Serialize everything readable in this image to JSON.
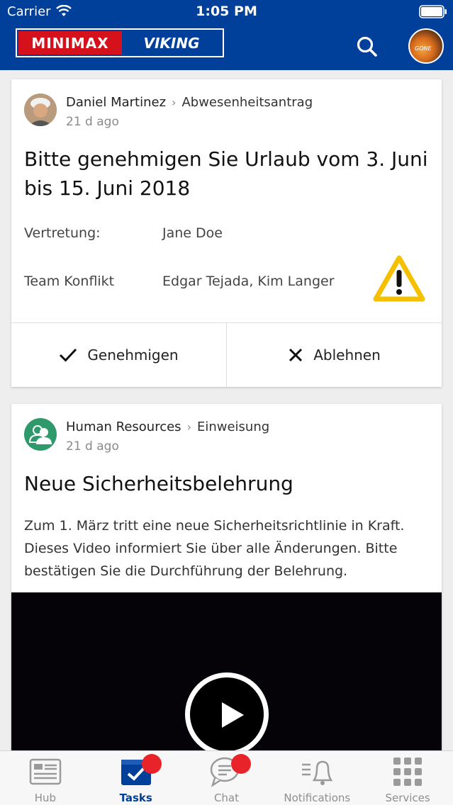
{
  "status_bar": {
    "carrier": "Carrier",
    "time": "1:05 PM"
  },
  "header": {
    "logo_left": "MINIMAX",
    "logo_right": "VIKING",
    "search_icon": "search-icon",
    "avatar_caption": "GONE"
  },
  "posts": [
    {
      "author": "Daniel Martinez",
      "type": "Abwesenheitsantrag",
      "time": "21 d ago",
      "title": "Bitte genehmigen Sie Urlaub vom 3. Juni bis 15. Juni 2018",
      "fields": [
        {
          "label": "Vertretung:",
          "value": "Jane Doe"
        },
        {
          "label": "Team Konflikt",
          "value": "Edgar Tejada, Kim Langer"
        }
      ],
      "warning_icon": "warning-icon",
      "actions": {
        "approve": "Genehmigen",
        "reject": "Ablehnen"
      }
    },
    {
      "author": "Human Resources",
      "type": "Einweisung",
      "time": "21 d ago",
      "title": "Neue Sicherheitsbelehrung",
      "body": "Zum 1. März tritt eine neue Sicherheitsrichtlinie in Kraft. Dieses Video informiert Sie über alle Änderungen. Bitte bestätigen Sie die Durchführung der Belehrung.",
      "video_icon": "play-icon"
    }
  ],
  "tabbar": {
    "items": [
      {
        "label": "Hub",
        "icon": "hub-icon",
        "active": false,
        "badge": false
      },
      {
        "label": "Tasks",
        "icon": "tasks-icon",
        "active": true,
        "badge": true
      },
      {
        "label": "Chat",
        "icon": "chat-icon",
        "active": false,
        "badge": true
      },
      {
        "label": "Notifications",
        "icon": "bell-icon",
        "active": false,
        "badge": false
      },
      {
        "label": "Services",
        "icon": "grid-icon",
        "active": false,
        "badge": false
      }
    ]
  },
  "colors": {
    "brand_blue": "#003f9a",
    "brand_red": "#d5121b",
    "badge_red": "#e8232a",
    "warning_yellow": "#f5c000",
    "hr_green": "#2e9a6b"
  }
}
